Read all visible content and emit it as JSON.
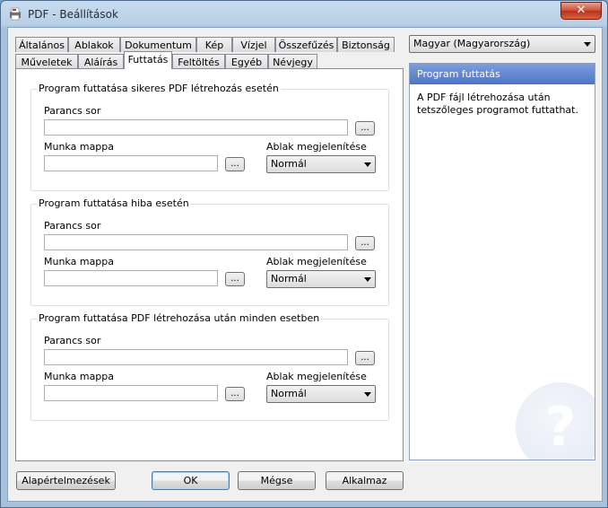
{
  "window": {
    "title": "PDF - Beállítások",
    "close_label": "✕"
  },
  "tabs_row1": [
    "Általános",
    "Ablakok",
    "Dokumentum",
    "Kép",
    "Vízjel",
    "Összefűzés",
    "Biztonság"
  ],
  "tabs_row2": [
    "Műveletek",
    "Aláírás",
    "Futtatás",
    "Feltöltés",
    "Egyéb",
    "Névjegy"
  ],
  "groups": [
    {
      "title": "Program futtatása sikeres PDF létrehozás esetén",
      "command_label": "Parancs sor",
      "folder_label": "Munka mappa",
      "window_label": "Ablak megjelenítése",
      "window_value": "Normál",
      "browse_label": "..."
    },
    {
      "title": "Program futtatása hiba esetén",
      "command_label": "Parancs sor",
      "folder_label": "Munka mappa",
      "window_label": "Ablak megjelenítése",
      "window_value": "Normál",
      "browse_label": "..."
    },
    {
      "title": "Program futtatása PDF létrehozása után minden esetben",
      "command_label": "Parancs sor",
      "folder_label": "Munka mappa",
      "window_label": "Ablak megjelenítése",
      "window_value": "Normál",
      "browse_label": "..."
    }
  ],
  "language": {
    "value": "Magyar (Magyarország)"
  },
  "help": {
    "title": "Program futtatás",
    "text": "A PDF fájl létrehozása után tetszőleges programot futtathat.",
    "icon_glyph": "?"
  },
  "buttons": {
    "defaults": "Alapértelmezések",
    "ok": "OK",
    "cancel": "Mégse",
    "apply": "Alkalmaz"
  },
  "colors": {
    "help_header": "#5a7fcf",
    "close_button": "#c8442c"
  },
  "icons": {
    "app": "pdf-printer-icon",
    "help": "question-mark-icon"
  }
}
